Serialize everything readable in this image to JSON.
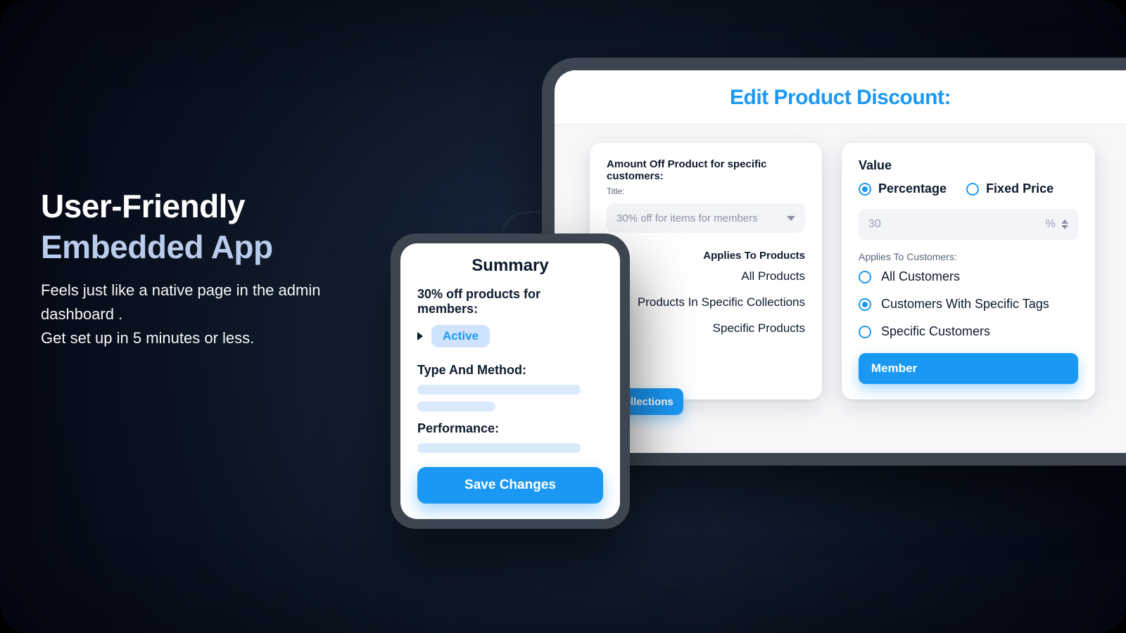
{
  "marketing": {
    "title_line1": "User-Friendly",
    "title_line2": "Embedded App",
    "paragraph": "Feels just like a native page in the admin dashboard .\nGet set up in 5 minutes or less."
  },
  "colors": {
    "accent": "#1b98f4",
    "accent_soft": "#b9cceb",
    "badge_bg": "#cfe3ff",
    "device_frame": "#3d4550"
  },
  "editor": {
    "title": "Edit Product Discount:",
    "amount_off": {
      "heading": "Amount Off Product for specific customers:",
      "title_label": "Title:",
      "select_value": "30% off for items for members"
    },
    "applies_products": {
      "heading": "Applies To Products",
      "options": [
        "All Products",
        "Products In Specific Collections",
        "Specific Products"
      ],
      "collections_button": "Collections"
    },
    "value": {
      "heading": "Value",
      "type_options": {
        "percentage": "Percentage",
        "fixed": "Fixed Price"
      },
      "selected_type": "percentage",
      "amount": "30",
      "unit": "%"
    },
    "applies_customers": {
      "heading": "Applies To Customers:",
      "options": [
        "All Customers",
        "Customers With Specific Tags",
        "Specific Customers"
      ],
      "selected_index": 1,
      "tag_button": "Member"
    }
  },
  "summary": {
    "title": "Summary",
    "discount_title": "30% off products for members:",
    "status_badge": "Active",
    "type_method_label": "Type And Method:",
    "performance_label": "Performance:",
    "save_button": "Save Changes"
  }
}
